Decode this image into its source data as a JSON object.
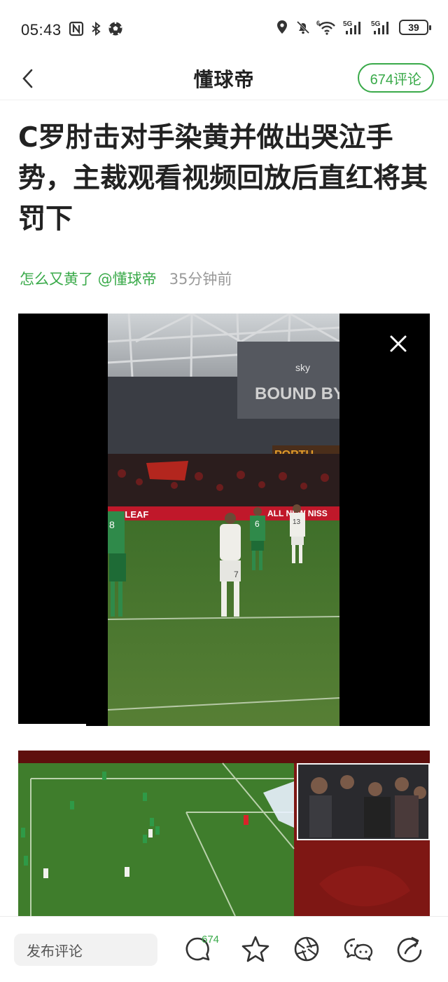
{
  "status_bar": {
    "time": "05:43",
    "battery": "39",
    "icons": [
      "nfc-icon",
      "bluetooth-icon",
      "soccer-icon",
      "location-icon",
      "mute-bell-icon",
      "wifi-6-icon",
      "signal-5g-icon",
      "signal-5g-icon",
      "battery-icon"
    ],
    "network_label_1": "5G",
    "network_label_2": "5G",
    "wifi_label": "6"
  },
  "nav": {
    "app_name": "懂球帝",
    "comment_button": "674评论"
  },
  "article": {
    "title": "C罗肘击对手染黄并做出哭泣手势，主裁观看视频回放后直红将其罚下",
    "tag": "怎么又黄了 @懂球帝",
    "time": "35分钟前"
  },
  "video": {
    "stadium_sign_1": "BOUND BY B",
    "stadium_sign_2": "sky",
    "stadium_sign_3": "PORTU",
    "board_left": "AN LEAF",
    "board_right": "ALL NEW NISS",
    "player_number_1": "8",
    "player_number_2": "6",
    "player_number_3": "7",
    "player_number_4": "13"
  },
  "bottom_bar": {
    "comment_placeholder": "发布评论",
    "comment_count": "674"
  },
  "colors": {
    "accent": "#3aaa4a",
    "text": "#222222",
    "muted": "#999999"
  }
}
